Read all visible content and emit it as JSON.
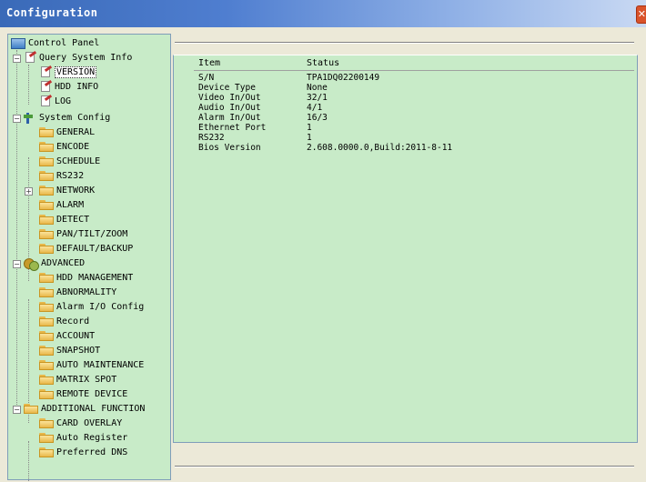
{
  "window": {
    "title": "Configuration"
  },
  "tree": {
    "root": "Control Panel",
    "query": {
      "label": "Query System Info",
      "items": [
        "VERSION",
        "HDD INFO",
        "LOG"
      ]
    },
    "system": {
      "label": "System Config",
      "items": [
        "GENERAL",
        "ENCODE",
        "SCHEDULE",
        "RS232",
        "NETWORK",
        "ALARM",
        "DETECT",
        "PAN/TILT/ZOOM",
        "DEFAULT/BACKUP"
      ]
    },
    "advanced": {
      "label": "ADVANCED",
      "items": [
        "HDD MANAGEMENT",
        "ABNORMALITY",
        "Alarm I/O Config",
        "Record",
        "ACCOUNT",
        "SNAPSHOT",
        "AUTO MAINTENANCE",
        "MATRIX SPOT",
        "REMOTE DEVICE"
      ]
    },
    "additional": {
      "label": "ADDITIONAL FUNCTION",
      "items": [
        "CARD OVERLAY",
        "Auto Register",
        "Preferred DNS"
      ]
    }
  },
  "info": {
    "headers": {
      "item": "Item",
      "status": "Status"
    },
    "rows": [
      {
        "key": "S/N",
        "value": "TPA1DQ02200149"
      },
      {
        "key": "Device Type",
        "value": "None"
      },
      {
        "key": "Video In/Out",
        "value": "32/1"
      },
      {
        "key": "Audio In/Out",
        "value": "4/1"
      },
      {
        "key": "Alarm In/Out",
        "value": "16/3"
      },
      {
        "key": "Ethernet Port",
        "value": "1"
      },
      {
        "key": "RS232",
        "value": "1"
      },
      {
        "key": "Bios Version",
        "value": "2.608.0000.0,Build:2011-8-11"
      }
    ]
  },
  "colors": {
    "panel_bg": "#c8ebc8",
    "title_bar": "#4f7ed0",
    "window_bg": "#ece9d8"
  }
}
